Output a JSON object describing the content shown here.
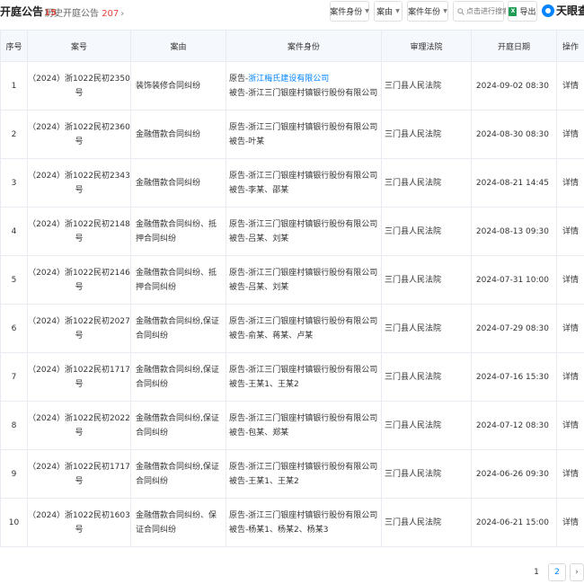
{
  "header": {
    "title": "开庭公告",
    "title_count": "15",
    "history_label": "历史开庭公告",
    "history_count": "207",
    "filters": {
      "identity": "案件身份",
      "reason": "案由",
      "year": "案件年份"
    },
    "search_placeholder": "点击进行搜索",
    "export_label": "导出",
    "logo_text": "天眼查"
  },
  "columns": [
    "序号",
    "案号",
    "案由",
    "案件身份",
    "审理法院",
    "开庭日期",
    "操作"
  ],
  "rows": [
    {
      "no": "1",
      "case": "（2024）浙1022民初2350号",
      "reason": "装饰装修合同纠纷",
      "plaintiff_prefix": "原告-",
      "plaintiff": "浙江梅氏建设有限公司",
      "plaintiff_link": true,
      "defendant": "被告-浙江三门银座村镇银行股份有限公司",
      "court": "三门县人民法院",
      "date": "2024-09-02 08:30",
      "op": "详情"
    },
    {
      "no": "2",
      "case": "（2024）浙1022民初2360号",
      "reason": "金融借款合同纠纷",
      "plaintiff_prefix": "原告-",
      "plaintiff": "浙江三门银座村镇银行股份有限公司",
      "plaintiff_link": false,
      "defendant": "被告-叶某",
      "court": "三门县人民法院",
      "date": "2024-08-30 08:30",
      "op": "详情"
    },
    {
      "no": "3",
      "case": "（2024）浙1022民初2343号",
      "reason": "金融借款合同纠纷",
      "plaintiff_prefix": "原告-",
      "plaintiff": "浙江三门银座村镇银行股份有限公司",
      "plaintiff_link": false,
      "defendant": "被告-李某、邵某",
      "court": "三门县人民法院",
      "date": "2024-08-21 14:45",
      "op": "详情"
    },
    {
      "no": "4",
      "case": "（2024）浙1022民初2148号",
      "reason": "金融借款合同纠纷、抵押合同纠纷",
      "plaintiff_prefix": "原告-",
      "plaintiff": "浙江三门银座村镇银行股份有限公司",
      "plaintiff_link": false,
      "defendant": "被告-吕某、刘某",
      "court": "三门县人民法院",
      "date": "2024-08-13 09:30",
      "op": "详情"
    },
    {
      "no": "5",
      "case": "（2024）浙1022民初2146号",
      "reason": "金融借款合同纠纷、抵押合同纠纷",
      "plaintiff_prefix": "原告-",
      "plaintiff": "浙江三门银座村镇银行股份有限公司",
      "plaintiff_link": false,
      "defendant": "被告-吕某、刘某",
      "court": "三门县人民法院",
      "date": "2024-07-31 10:00",
      "op": "详情"
    },
    {
      "no": "6",
      "case": "（2024）浙1022民初2027号",
      "reason": "金融借款合同纠纷,保证合同纠纷",
      "plaintiff_prefix": "原告-",
      "plaintiff": "浙江三门银座村镇银行股份有限公司",
      "plaintiff_link": false,
      "defendant": "被告-俞某、蒋某、卢某",
      "court": "三门县人民法院",
      "date": "2024-07-29 08:30",
      "op": "详情"
    },
    {
      "no": "7",
      "case": "（2024）浙1022民初1717号",
      "reason": "金融借款合同纠纷,保证合同纠纷",
      "plaintiff_prefix": "原告-",
      "plaintiff": "浙江三门银座村镇银行股份有限公司",
      "plaintiff_link": false,
      "defendant": "被告-王某1、王某2",
      "court": "三门县人民法院",
      "date": "2024-07-16 15:30",
      "op": "详情"
    },
    {
      "no": "8",
      "case": "（2024）浙1022民初2022号",
      "reason": "金融借款合同纠纷,保证合同纠纷",
      "plaintiff_prefix": "原告-",
      "plaintiff": "浙江三门银座村镇银行股份有限公司",
      "plaintiff_link": false,
      "defendant": "被告-包某、郑某",
      "court": "三门县人民法院",
      "date": "2024-07-12 08:30",
      "op": "详情"
    },
    {
      "no": "9",
      "case": "（2024）浙1022民初1717号",
      "reason": "金融借款合同纠纷,保证合同纠纷",
      "plaintiff_prefix": "原告-",
      "plaintiff": "浙江三门银座村镇银行股份有限公司",
      "plaintiff_link": false,
      "defendant": "被告-王某1、王某2",
      "court": "三门县人民法院",
      "date": "2024-06-26 09:30",
      "op": "详情"
    },
    {
      "no": "10",
      "case": "（2024）浙1022民初1603号",
      "reason": "金融借款合同纠纷、保证合同纠纷",
      "plaintiff_prefix": "原告-",
      "plaintiff": "浙江三门银座村镇银行股份有限公司",
      "plaintiff_link": false,
      "defendant": "被告-杨某1、杨某2、杨某3",
      "court": "三门县人民法院",
      "date": "2024-06-21 15:00",
      "op": "详情"
    }
  ],
  "pagination": {
    "page1": "1",
    "page2": "2",
    "next": "›"
  },
  "colors": {
    "accent": "#0084ff",
    "count_red": "#e6433a",
    "header_bg": "#f5f8fc"
  }
}
